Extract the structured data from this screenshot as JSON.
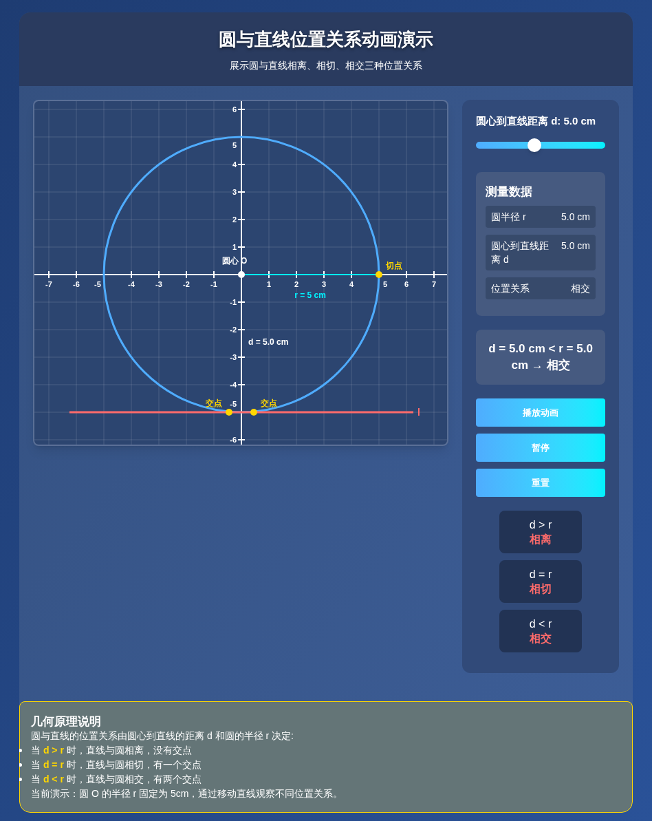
{
  "header": {
    "title": "圆与直线位置关系动画演示",
    "subtitle": "展示圆与直线相离、相切、相交三种位置关系"
  },
  "graph": {
    "x_ticks": [
      "-7",
      "-6",
      "-5",
      "-4",
      "-3",
      "-2",
      "-1",
      "1",
      "2",
      "3",
      "4",
      "5",
      "6",
      "7"
    ],
    "y_ticks": [
      "6",
      "5",
      "4",
      "3",
      "2",
      "1",
      "-1",
      "-2",
      "-3",
      "-4",
      "-5",
      "-6"
    ],
    "center_label": "圆心 O",
    "radius_label": "r = 5 cm",
    "distance_label": "d = 5.0 cm",
    "tangent_label": "切点",
    "intersection_labels": [
      "交点",
      "交点"
    ],
    "line_label": "l"
  },
  "slider": {
    "label": "圆心到直线距离 d: 5.0 cm",
    "level": 0.45
  },
  "measurements": {
    "title": "测量数据",
    "rows": [
      {
        "label": "圆半径 r",
        "value": "5.0 cm"
      },
      {
        "label": "圆心到直线距离 d",
        "value": "5.0 cm"
      },
      {
        "label": "位置关系",
        "value": "相交"
      }
    ]
  },
  "formula": "d = 5.0 cm < r = 5.0 cm → 相交",
  "buttons": [
    "播放动画",
    "暂停",
    "重置"
  ],
  "relations": [
    {
      "condition": "d > r",
      "name": "相离"
    },
    {
      "condition": "d = r",
      "name": "相切"
    },
    {
      "condition": "d < r",
      "name": "相交"
    }
  ],
  "explanation": {
    "title": "几何原理说明",
    "intro": "圆与直线的位置关系由圆心到直线的距离 d 和圆的半径 r 决定:",
    "bullets": [
      "当 **d > r** 时，直线与圆相离，没有交点",
      "当 **d = r** 时，直线与圆相切，有一个交点",
      "当 **d < r** 时，直线与圆相交，有两个交点"
    ],
    "footer": "当前演示：圆 O 的半径 r 固定为 5cm，通过移动直线观察不同位置关系。"
  }
}
